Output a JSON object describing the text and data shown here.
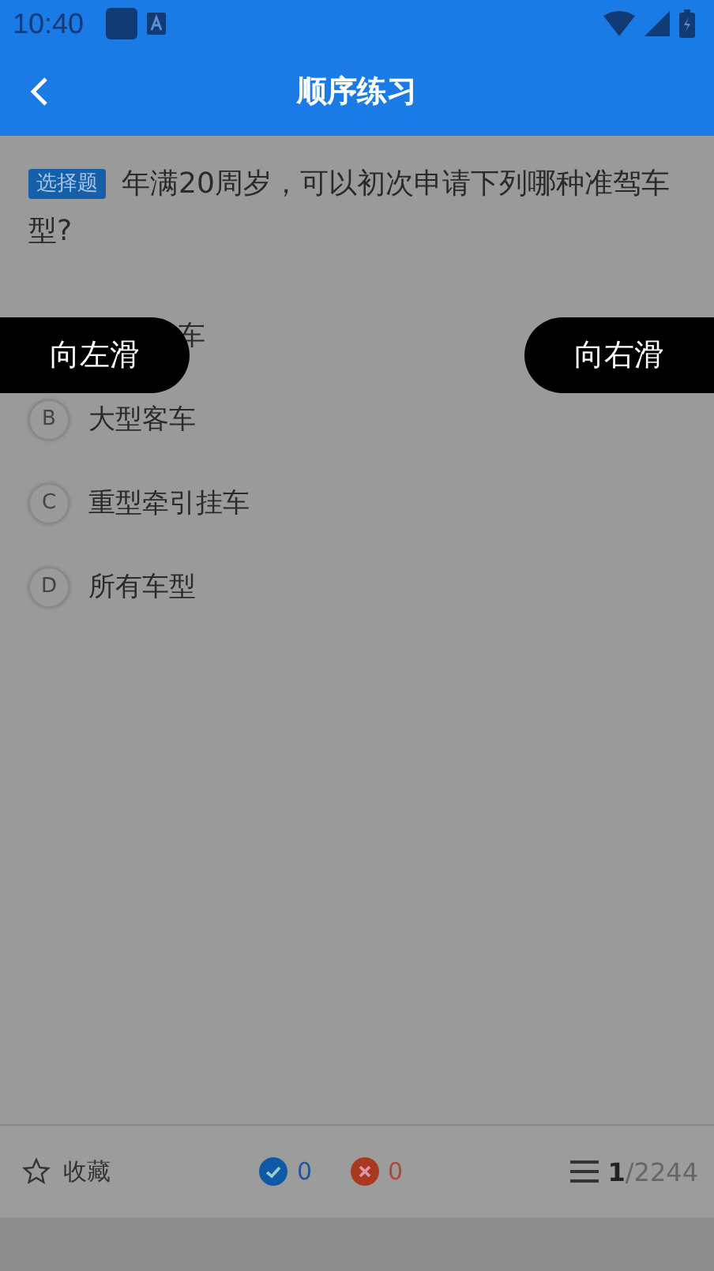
{
  "status_bar": {
    "time": "10:40"
  },
  "header": {
    "title": "顺序练习"
  },
  "question": {
    "tag": "选择题",
    "text": "年满20周岁，可以初次申请下列哪种准驾车型?"
  },
  "options": [
    {
      "kind": "covered",
      "text": "车"
    },
    {
      "kind": "normal",
      "letter": "B",
      "text": "大型客车"
    },
    {
      "kind": "normal",
      "letter": "C",
      "text": "重型牵引挂车"
    },
    {
      "kind": "normal",
      "letter": "D",
      "text": "所有车型"
    }
  ],
  "swipe_hints": [
    {
      "kind": "left",
      "label": "向左滑"
    },
    {
      "kind": "right",
      "label": "向右滑"
    }
  ],
  "bottom_bar": {
    "favorite": "收藏",
    "correct": "0",
    "wrong": "0",
    "current": "1",
    "total": "/2244"
  }
}
